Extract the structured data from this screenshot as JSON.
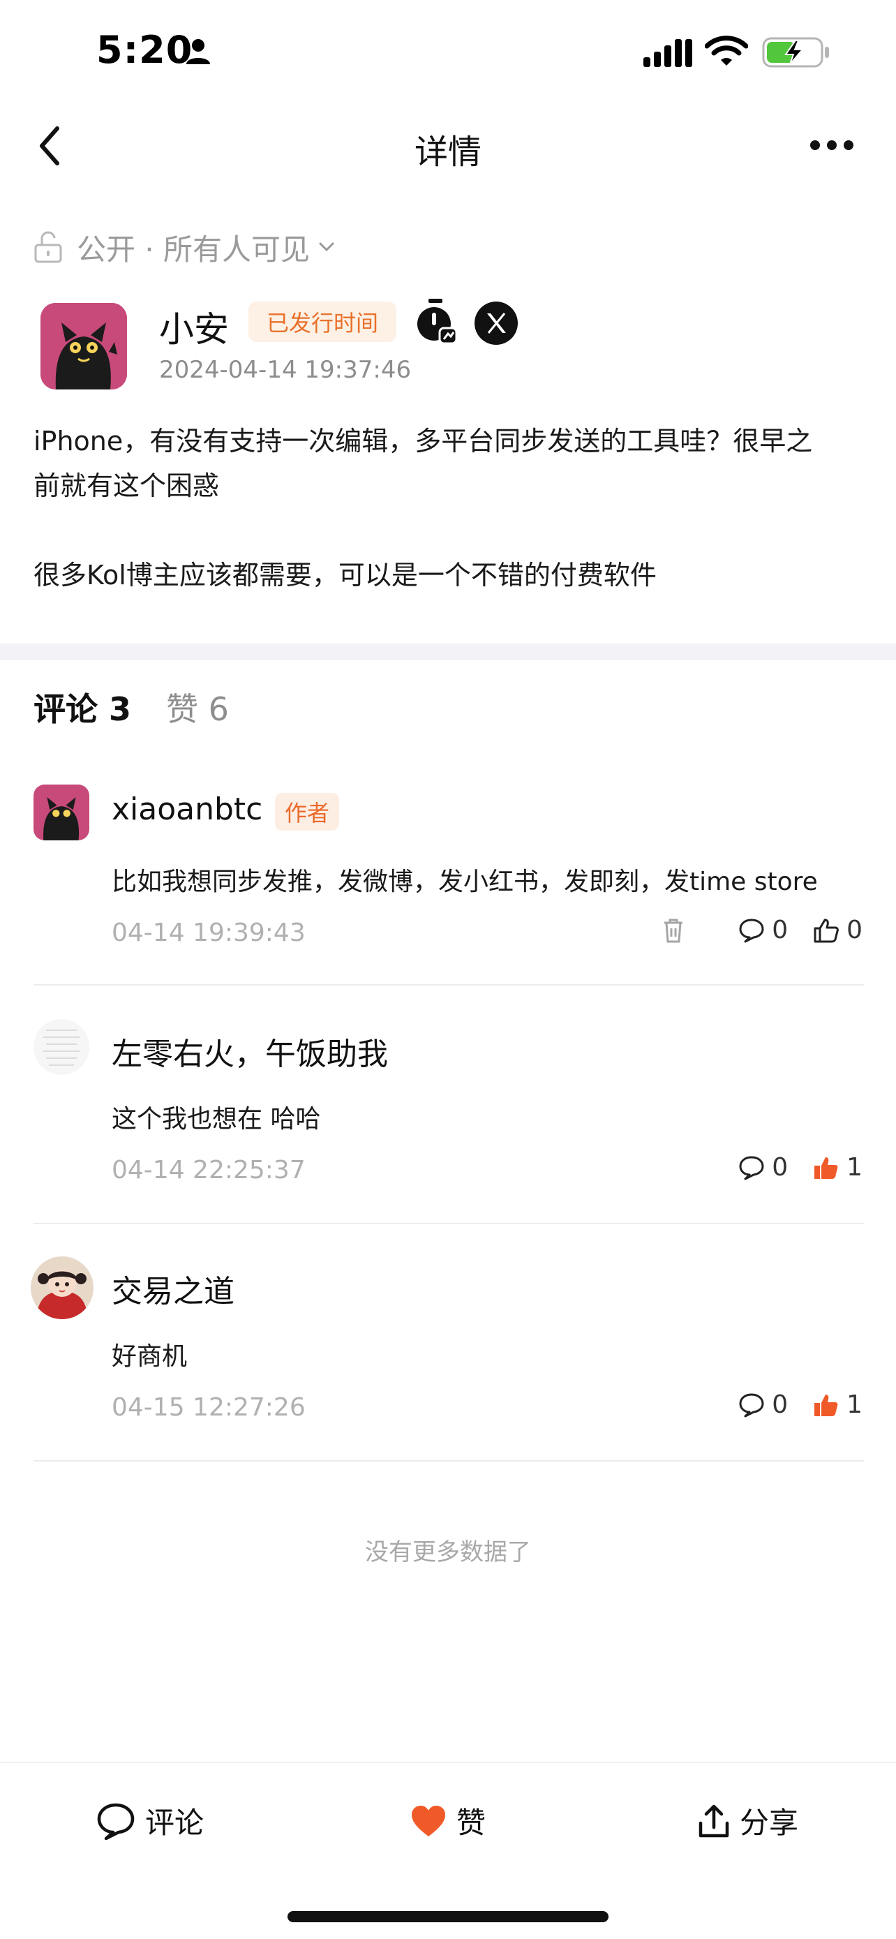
{
  "status_bar": {
    "time": "5:20"
  },
  "nav": {
    "title": "详情"
  },
  "post": {
    "privacy_label": "公开 · 所有人可见",
    "author_name": "小安",
    "badge_label": "已发行时间",
    "timestamp": "2024-04-14 19:37:46",
    "body_line1": "iPhone，有没有支持一次编辑，多平台同步发送的工具哇？很早之",
    "body_line2": "前就有这个困惑",
    "body_line3": "很多Kol博主应该都需要，可以是一个不错的付费软件"
  },
  "tabs": {
    "comments": "评论 3",
    "likes": "赞 6"
  },
  "comments": [
    {
      "name": "xiaoanbtc",
      "author_badge": "作者",
      "text": "比如我想同步发推，发微博，发小红书，发即刻，发time store",
      "time": "04-14 19:39:43",
      "reply_count": "0",
      "like_count": "0"
    },
    {
      "name": "左零右火，午饭助我",
      "text": "这个我也想在  哈哈",
      "time": "04-14 22:25:37",
      "reply_count": "0",
      "like_count": "1"
    },
    {
      "name": "交易之道",
      "text": "好商机",
      "time": "04-15 12:27:26",
      "reply_count": "0",
      "like_count": "1"
    }
  ],
  "footer_note": "没有更多数据了",
  "bottom_bar": {
    "comment": "评论",
    "like": "赞",
    "share": "分享"
  },
  "colors": {
    "accent": "#e8712b",
    "like_active": "#f05a28",
    "badge_bg": "#fdf0e4"
  }
}
